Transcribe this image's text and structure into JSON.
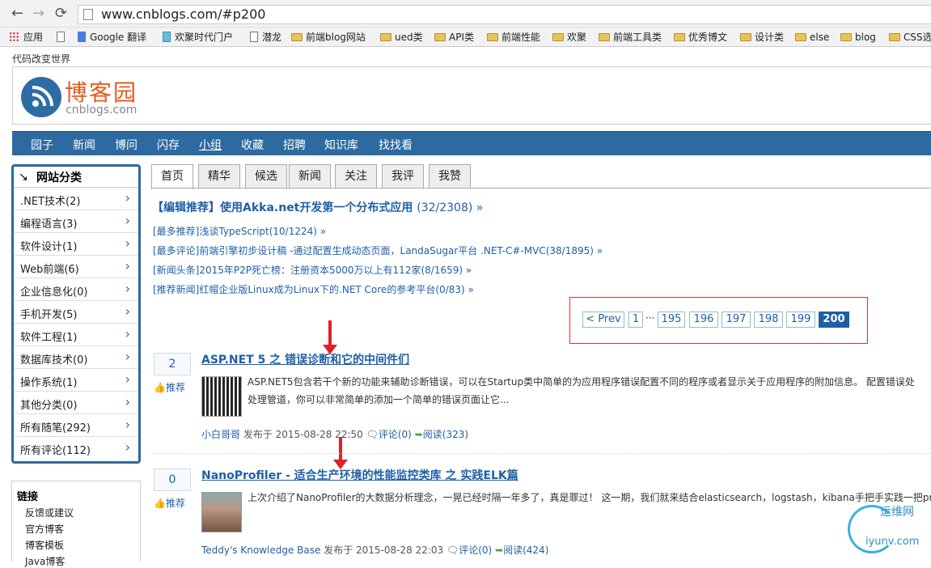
{
  "browser": {
    "url": "www.cnblogs.com/#p200"
  },
  "bookmarks": [
    "应用",
    "",
    "Google 翻译",
    "欢聚时代门户",
    "潜龙",
    "前端blog网站",
    "ued类",
    "API类",
    "前端性能",
    "欢聚",
    "前端工具类",
    "优秀博文",
    "设计类",
    "else",
    "blog",
    "CSS选"
  ],
  "site": {
    "slogan": "代码改变世界",
    "logo_title": "博客园",
    "logo_sub": "cnblogs.com"
  },
  "topnav": [
    "园子",
    "新闻",
    "博问",
    "闪存",
    "小组",
    "收藏",
    "招聘",
    "知识库",
    "找找看"
  ],
  "categories": {
    "title": "网站分类",
    "items": [
      ".NET技术(2)",
      "编程语言(3)",
      "软件设计(1)",
      "Web前端(6)",
      "企业信息化(0)",
      "手机开发(5)",
      "软件工程(1)",
      "数据库技术(0)",
      "操作系统(1)",
      "其他分类(0)",
      "所有随笔(292)",
      "所有评论(112)"
    ]
  },
  "links": {
    "title": "链接",
    "items": [
      "反馈或建议",
      "官方博客",
      "博客模板",
      "Java博客"
    ]
  },
  "tabs": [
    "首页",
    "精华",
    "候选",
    "新闻",
    "关注",
    "我评",
    "我赞"
  ],
  "editor_pick": {
    "label": "【编辑推荐】使用Akka.net开发第一个分布式应用",
    "count": "(32/2308) »"
  },
  "recs": [
    "[最多推荐]浅谈TypeScript(10/1224) »",
    "[最多评论]前端引擎初步设计稿 -通过配置生成动态页面，LandaSugar平台 .NET-C#-MVC(38/1895) »",
    "[新闻头条]2015年P2P死亡榜：注册资本5000万以上有112家(8/1659) »",
    "[推荐新闻]红帽企业版Linux成为Linux下的.NET Core的参考平台(0/83) »"
  ],
  "pager": {
    "prev": "< Prev",
    "first": "1",
    "ellipsis": "···",
    "pages": [
      "195",
      "196",
      "197",
      "198",
      "199"
    ],
    "current": "200"
  },
  "posts": [
    {
      "digg": "2",
      "recommend": "推荐",
      "title": "ASP.NET 5 之 错误诊断和它的中间件们",
      "line1": "ASP.NET5包含若干个新的功能来辅助诊断错误，可以在Startup类中简单的为应用程序错误配置不同的程序或者显示关于应用程序的附加信息。 配置错误处",
      "line2": "处理管道，你可以非常简单的添加一个简单的错误页面让它...",
      "author": "小白哥哥",
      "date": "发布于 2015-08-28 22:50",
      "comments": "评论(0)",
      "reads": "阅读(323)"
    },
    {
      "digg": "0",
      "recommend": "推荐",
      "title": "NanoProfiler - 适合生产环境的性能监控类库 之 实践ELK篇",
      "line1": "上次介绍了NanoProfiler的大数据分析理念，一晃已经时隔一年多了，真是罪过！ 这一期，我们就来结合elasticsearch，logstash，kibana手把手实践一把pro",
      "line2": "",
      "author": "Teddy's Knowledge Base",
      "date": "发布于 2015-08-28 22:03",
      "comments": "评论(0)",
      "reads": "阅读(424)"
    }
  ],
  "watermark": {
    "cn": "运维网",
    "en": "iyunv.com"
  }
}
